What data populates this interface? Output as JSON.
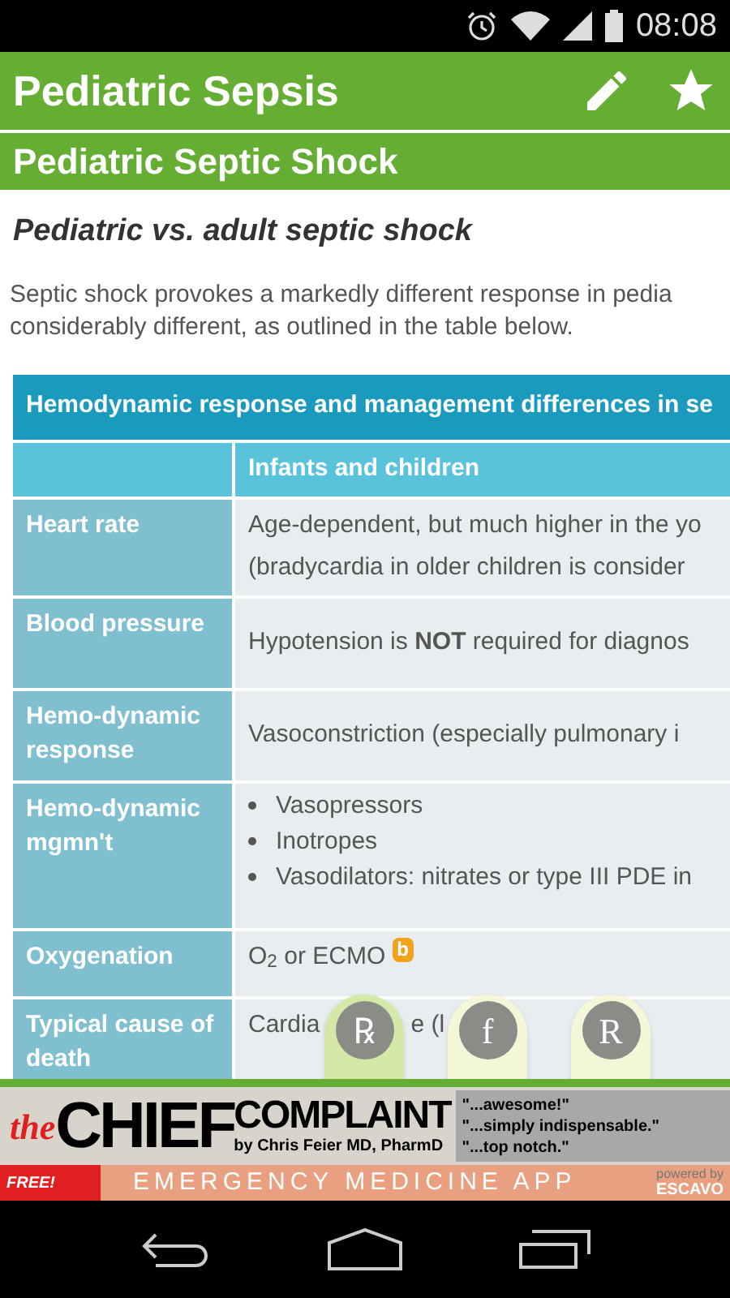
{
  "status_bar": {
    "time": "08:08"
  },
  "app_bar": {
    "title": "Pediatric Sepsis"
  },
  "section": {
    "title": "Pediatric Septic Shock"
  },
  "heading": "Pediatric vs. adult septic shock",
  "intro": [
    "Septic shock provokes a markedly different response in pedia",
    "considerably different, as outlined in the table below."
  ],
  "table": {
    "title": "Hemodynamic response and management differences in se",
    "columns": [
      "Infants and children"
    ],
    "rows": [
      {
        "label": "Heart rate",
        "kind": "lines",
        "lines": [
          "Age-dependent, but much higher in the yo",
          "(bradycardia in older children is consider"
        ]
      },
      {
        "label": "Blood pressure",
        "kind": "lines",
        "lines": [
          "Hypotension is **NOT** required for diagnos"
        ]
      },
      {
        "label": "Hemo-dynamic response",
        "kind": "lines",
        "lines": [
          "Vasoconstriction (especially pulmonary i"
        ]
      },
      {
        "label": "Hemo-dynamic mgmn't",
        "kind": "bullets",
        "lines": [
          "Vasopressors",
          "Inotropes",
          "Vasodilators: nitrates or type III PDE in"
        ]
      },
      {
        "label": "Oxygenation",
        "kind": "badge",
        "lines": [
          "O$_{2}$ or ECMO"
        ],
        "badge": "b"
      },
      {
        "label": "Typical cause of death",
        "kind": "covered",
        "lines": [
          "Cardia",
          "e (l"
        ]
      }
    ]
  },
  "tabs": [
    {
      "label": "℞",
      "selected": true
    },
    {
      "label": "f",
      "selected": false
    },
    {
      "label": "R",
      "selected": false
    }
  ],
  "ad": {
    "the": "the",
    "chief": "CHIEF",
    "complaint": "COMPLAINT",
    "byline": "by Chris Feier MD, PharmD",
    "quotes": [
      "\"...awesome!\"",
      "\"...simply indispensable.\"",
      "\"...top notch.\""
    ],
    "free": "FREE!",
    "tagline": "EMERGENCY MEDICINE APP",
    "powered": "powered by",
    "brand": "ESCAVO"
  }
}
